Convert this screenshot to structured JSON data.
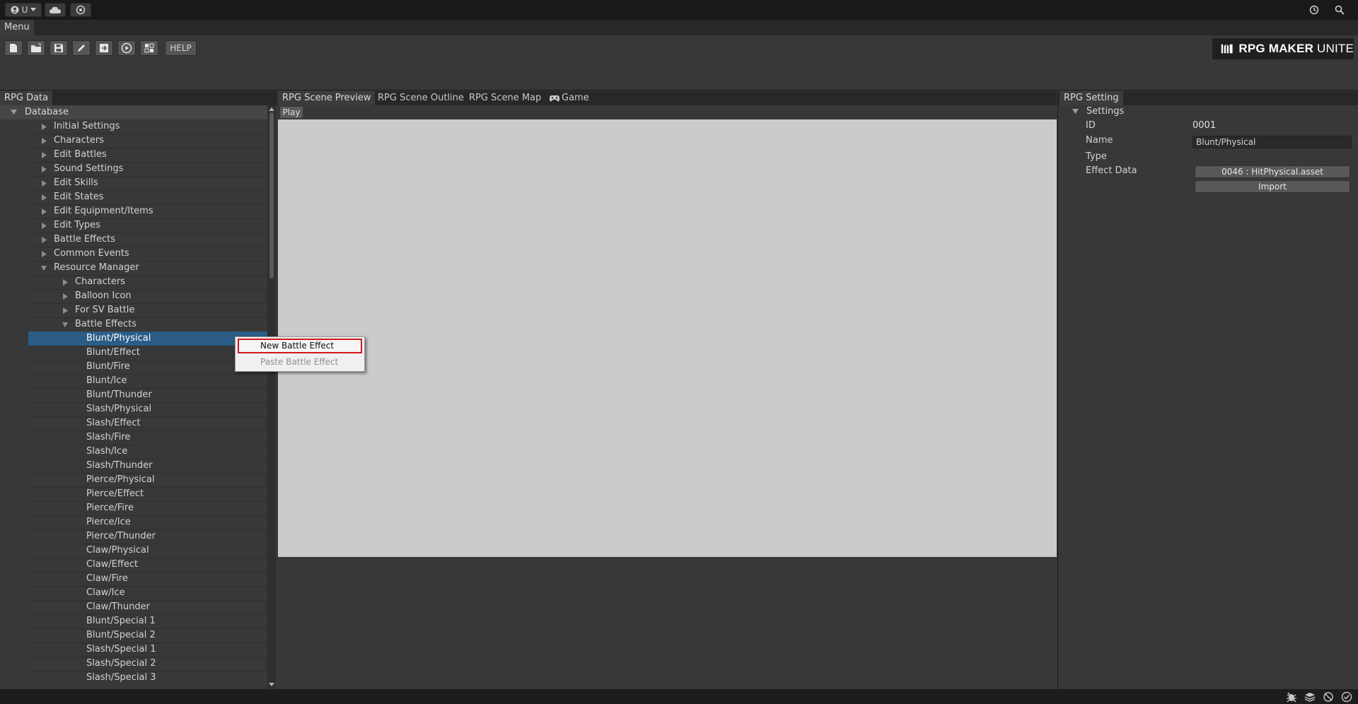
{
  "topbar": {
    "account_label": "U",
    "icons": [
      "account-icon",
      "cloud-icon",
      "collab-icon",
      "history-icon",
      "search-icon"
    ]
  },
  "menubar": {
    "menu_label": "Menu"
  },
  "toolbar": {
    "help_label": "HELP",
    "tools": [
      "new-project-icon",
      "open-project-icon",
      "save-icon",
      "edit-icon",
      "export-icon",
      "play-icon",
      "addon-icon"
    ],
    "logo_main": "RPG MAKER",
    "logo_sub": "UNITE"
  },
  "left_panel": {
    "tab": "RPG Data",
    "root_label": "Database",
    "items": [
      {
        "label": "Initial Settings",
        "level": 1,
        "arrow": "collapsed"
      },
      {
        "label": "Characters",
        "level": 1,
        "arrow": "collapsed"
      },
      {
        "label": "Edit Battles",
        "level": 1,
        "arrow": "collapsed"
      },
      {
        "label": "Sound Settings",
        "level": 1,
        "arrow": "collapsed"
      },
      {
        "label": "Edit Skills",
        "level": 1,
        "arrow": "collapsed"
      },
      {
        "label": "Edit States",
        "level": 1,
        "arrow": "collapsed"
      },
      {
        "label": "Edit Equipment/Items",
        "level": 1,
        "arrow": "collapsed"
      },
      {
        "label": "Edit Types",
        "level": 1,
        "arrow": "collapsed"
      },
      {
        "label": "Battle Effects",
        "level": 1,
        "arrow": "collapsed"
      },
      {
        "label": "Common Events",
        "level": 1,
        "arrow": "collapsed"
      },
      {
        "label": "Resource Manager",
        "level": 1,
        "arrow": "expanded"
      },
      {
        "label": "Characters",
        "level": 2,
        "arrow": "collapsed"
      },
      {
        "label": "Balloon Icon",
        "level": 2,
        "arrow": "collapsed"
      },
      {
        "label": "For SV Battle",
        "level": 2,
        "arrow": "collapsed"
      },
      {
        "label": "Battle Effects",
        "level": 2,
        "arrow": "expanded"
      },
      {
        "label": "Blunt/Physical",
        "level": 3,
        "selected": true
      },
      {
        "label": "Blunt/Effect",
        "level": 3
      },
      {
        "label": "Blunt/Fire",
        "level": 3
      },
      {
        "label": "Blunt/Ice",
        "level": 3
      },
      {
        "label": "Blunt/Thunder",
        "level": 3
      },
      {
        "label": "Slash/Physical",
        "level": 3
      },
      {
        "label": "Slash/Effect",
        "level": 3
      },
      {
        "label": "Slash/Fire",
        "level": 3
      },
      {
        "label": "Slash/Ice",
        "level": 3
      },
      {
        "label": "Slash/Thunder",
        "level": 3
      },
      {
        "label": "Pierce/Physical",
        "level": 3
      },
      {
        "label": "Pierce/Effect",
        "level": 3
      },
      {
        "label": "Pierce/Fire",
        "level": 3
      },
      {
        "label": "Pierce/Ice",
        "level": 3
      },
      {
        "label": "Pierce/Thunder",
        "level": 3
      },
      {
        "label": "Claw/Physical",
        "level": 3
      },
      {
        "label": "Claw/Effect",
        "level": 3
      },
      {
        "label": "Claw/Fire",
        "level": 3
      },
      {
        "label": "Claw/Ice",
        "level": 3
      },
      {
        "label": "Claw/Thunder",
        "level": 3
      },
      {
        "label": "Blunt/Special 1",
        "level": 3
      },
      {
        "label": "Blunt/Special 2",
        "level": 3
      },
      {
        "label": "Slash/Special 1",
        "level": 3
      },
      {
        "label": "Slash/Special 2",
        "level": 3
      },
      {
        "label": "Slash/Special 3",
        "level": 3
      }
    ]
  },
  "context_menu": {
    "new_label": "New Battle Effect",
    "paste_label": "Paste Battle Effect"
  },
  "center_panel": {
    "tabs": [
      "RPG Scene Preview",
      "RPG Scene Outline",
      "RPG Scene Map",
      "Game"
    ],
    "game_tab_icon": "gamepad-icon",
    "play_label": "Play"
  },
  "right_panel": {
    "tab": "RPG Setting",
    "section": "Settings",
    "id_label": "ID",
    "id_value": "0001",
    "name_label": "Name",
    "name_value": "Blunt/Physical",
    "type_label": "Type",
    "effect_label": "Effect Data",
    "effect_value": "0046 : HitPhysical.asset",
    "import_label": "Import"
  },
  "statusbar": {
    "icons": [
      "debug-icon",
      "layers-icon",
      "network-icon",
      "check-icon"
    ]
  },
  "colors": {
    "selection": "#2c5d87",
    "highlight_border": "#d0171f",
    "preview_bg": "#cbcbcb"
  }
}
